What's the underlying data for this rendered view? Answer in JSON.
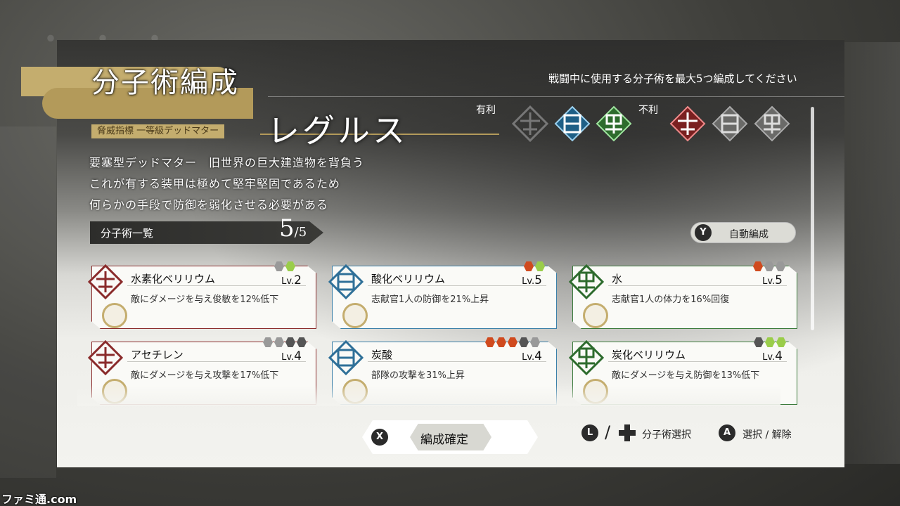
{
  "header": {
    "title": "分子術編成",
    "instruction": "戦闘中に使用する分子術を最大5つ編成してください"
  },
  "enemy": {
    "classification": "脅威指標 一等級デッドマター",
    "name": "レグルス",
    "description": [
      "要塞型デッドマター　旧世界の巨大建造物を背負う",
      "これが有する装甲は極めて堅牢堅固であるため",
      "何らかの手段で防御を弱化させる必要がある"
    ],
    "advantage_label": "有利",
    "disadvantage_label": "不利"
  },
  "list": {
    "header": "分子術一覧",
    "count_current": "5",
    "count_max": "/5",
    "auto_button": {
      "key": "Y",
      "label": "自動編成"
    }
  },
  "cards": [
    {
      "name": "水素化ベリリウム",
      "lv_prefix": "Lv.",
      "level": "2",
      "effect": "敵にダメージを与え俊敏を12%低下",
      "color": "#8a2b2b"
    },
    {
      "name": "酸化ベリリウム",
      "lv_prefix": "Lv.",
      "level": "5",
      "effect": "志献官1人の防御を21%上昇",
      "color": "#3a7fa8"
    },
    {
      "name": "水",
      "lv_prefix": "Lv.",
      "level": "5",
      "effect": "志献官1人の体力を16%回復",
      "color": "#3a7a3a"
    },
    {
      "name": "アセチレン",
      "lv_prefix": "Lv.",
      "level": "4",
      "effect": "敵にダメージを与え攻撃を17%低下",
      "color": "#8a2b2b"
    },
    {
      "name": "炭酸",
      "lv_prefix": "Lv.",
      "level": "4",
      "effect": "部隊の攻撃を31%上昇",
      "color": "#3a7fa8"
    },
    {
      "name": "炭化ベリリウム",
      "lv_prefix": "Lv.",
      "level": "4",
      "effect": "敵にダメージを与え防御を13%低下",
      "color": "#3a7a3a"
    }
  ],
  "footer": {
    "confirm_key": "X",
    "confirm_label": "編成確定",
    "select_key": "L",
    "select_label": "分子術選択",
    "toggle_key": "A",
    "toggle_label": "選択 / 解除"
  },
  "watermark": "ファミ通.com"
}
